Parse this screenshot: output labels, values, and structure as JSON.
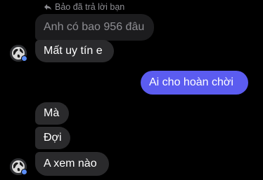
{
  "reply_note": {
    "icon": "reply-arrow-icon",
    "text": "Bảo đã trả lời bạn"
  },
  "messages": {
    "quoted_text": "Anh có bao 956 đâu",
    "in_1": "Mất uy tín e",
    "out_1": "Ai cho hoàn chời",
    "in_2": "Mà",
    "in_3": "Đợi",
    "in_4": "A xem nào"
  },
  "colors": {
    "background": "#000000",
    "incoming_bubble": "#2a2a2c",
    "quoted_bubble": "#1c1c1e",
    "outgoing_bubble": "#5b5cf0",
    "secondary_text": "#8e8e93"
  }
}
